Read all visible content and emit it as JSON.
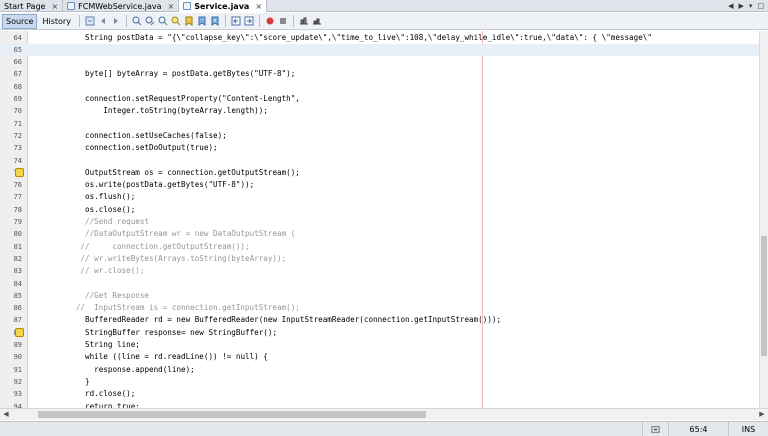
{
  "tabs": [
    {
      "label": "Start Page",
      "active": false,
      "closable": true,
      "icon": ""
    },
    {
      "label": "FCMWebService.java",
      "active": false,
      "closable": true,
      "icon": "java-file-icon"
    },
    {
      "label": "Service.java",
      "active": true,
      "closable": true,
      "icon": "java-file-icon"
    }
  ],
  "tab_controls": [
    "◀",
    "▶",
    "▾",
    "□"
  ],
  "view_tabs": {
    "source": "Source",
    "history": "History"
  },
  "toolbar_icons": [
    "last-edit-icon",
    "back-icon",
    "forward-icon",
    "find-selection-icon",
    "find-previous-icon",
    "find-next-icon",
    "toggle-highlight-icon",
    "toggle-bookmark-icon",
    "previous-bookmark-icon",
    "next-bookmark-icon",
    "shift-left-icon",
    "shift-right-icon",
    "record-macro-icon",
    "stop-macro-icon",
    "comment-icon",
    "uncomment-icon"
  ],
  "editor": {
    "lines": [
      {
        "n": "64",
        "pad": 4,
        "text": "String postData = \"{\\\"collapse_key\\\":\\\"score_update\\\",\\\"time_to_live\\\":108,\\\"delay_while_idle\\\":true,\\\"data\\\": { \\\"message\\\"",
        "kind": "code"
      },
      {
        "n": "65",
        "pad": 0,
        "text": "",
        "kind": "code",
        "current": true
      },
      {
        "n": "66",
        "pad": 0,
        "text": "",
        "kind": "code"
      },
      {
        "n": "67",
        "pad": 4,
        "text": "byte[] byteArray = postData.getBytes(\"UTF-8\");",
        "kind": "code"
      },
      {
        "n": "68",
        "pad": 0,
        "text": "",
        "kind": "code"
      },
      {
        "n": "69",
        "pad": 4,
        "text": "connection.setRequestProperty(\"Content-Length\",",
        "kind": "code"
      },
      {
        "n": "70",
        "pad": 8,
        "text": "Integer.toString(byteArray.length));",
        "kind": "code"
      },
      {
        "n": "71",
        "pad": 0,
        "text": "",
        "kind": "code"
      },
      {
        "n": "72",
        "pad": 4,
        "text": "connection.setUseCaches(false);",
        "kind": "code"
      },
      {
        "n": "73",
        "pad": 4,
        "text": "connection.setDoOutput(true);",
        "kind": "code"
      },
      {
        "n": "74",
        "pad": 0,
        "text": "",
        "kind": "code"
      },
      {
        "n": "75",
        "pad": 4,
        "text": "OutputStream os = connection.getOutputStream();",
        "kind": "code",
        "hint": true
      },
      {
        "n": "76",
        "pad": 4,
        "text": "os.write(postData.getBytes(\"UTF-8\"));",
        "kind": "code"
      },
      {
        "n": "77",
        "pad": 4,
        "text": "os.flush();",
        "kind": "code"
      },
      {
        "n": "78",
        "pad": 4,
        "text": "os.close();",
        "kind": "code"
      },
      {
        "n": "79",
        "pad": 4,
        "text": "//Send request",
        "kind": "comment"
      },
      {
        "n": "80",
        "pad": 4,
        "text": "//DataOutputStream wr = new DataOutputStream (",
        "kind": "comment"
      },
      {
        "n": "81",
        "pad": 3,
        "text": "//     connection.getOutputStream());",
        "kind": "comment"
      },
      {
        "n": "82",
        "pad": 3,
        "text": "// wr.writeBytes(Arrays.toString(byteArray));",
        "kind": "comment"
      },
      {
        "n": "83",
        "pad": 3,
        "text": "// wr.close();",
        "kind": "comment"
      },
      {
        "n": "84",
        "pad": 0,
        "text": "",
        "kind": "code"
      },
      {
        "n": "85",
        "pad": 4,
        "text": "//Get Response",
        "kind": "comment"
      },
      {
        "n": "86",
        "pad": 2,
        "text": "//  InputStream is = connection.getInputStream();",
        "kind": "comment"
      },
      {
        "n": "87",
        "pad": 4,
        "text": "BufferedReader rd = new BufferedReader(new InputStreamReader(connection.getInputStream()));",
        "kind": "code"
      },
      {
        "n": "88",
        "pad": 4,
        "text": "StringBuffer response= new StringBuffer();",
        "kind": "code",
        "hint": true
      },
      {
        "n": "89",
        "pad": 4,
        "text": "String line;",
        "kind": "code"
      },
      {
        "n": "90",
        "pad": 4,
        "text": "while ((line = rd.readLine()) != null) {",
        "kind": "code"
      },
      {
        "n": "91",
        "pad": 6,
        "text": "response.append(line);",
        "kind": "code"
      },
      {
        "n": "92",
        "pad": 4,
        "text": "}",
        "kind": "code"
      },
      {
        "n": "93",
        "pad": 4,
        "text": "rd.close();",
        "kind": "code"
      },
      {
        "n": "94",
        "pad": 4,
        "text": "return true;",
        "kind": "code"
      }
    ]
  },
  "status": {
    "position": "65:4",
    "mode": "INS"
  }
}
